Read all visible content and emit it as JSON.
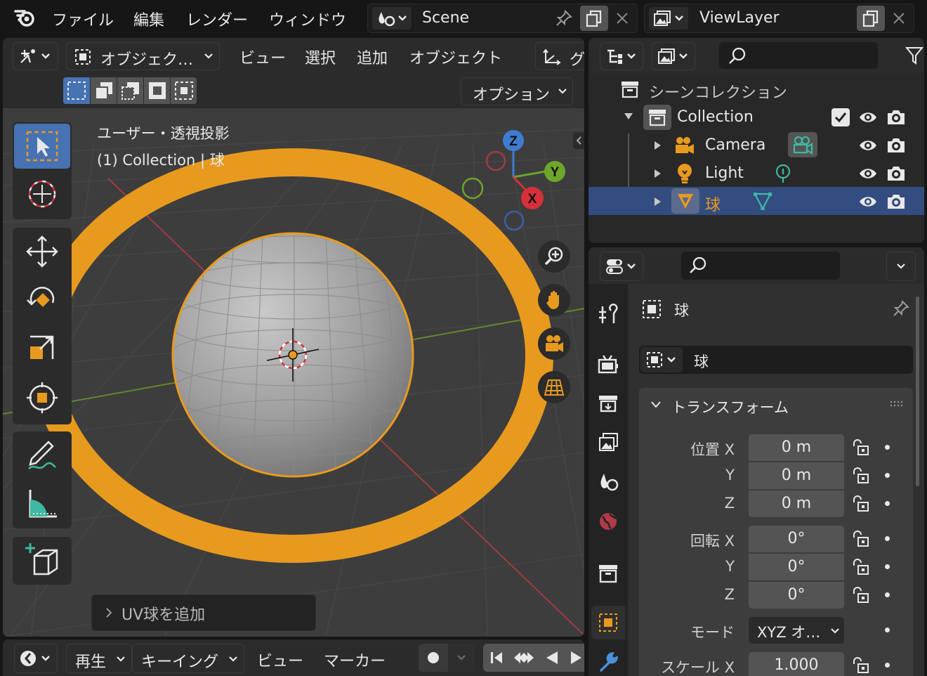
{
  "topbar": {
    "menu": [
      "ファイル",
      "編集",
      "レンダー",
      "ウィンドウ"
    ],
    "scene_name": "Scene",
    "viewlayer_name": "ViewLayer"
  },
  "viewport_header": {
    "mode_label": "オブジェク…",
    "menus": [
      "ビュー",
      "選択",
      "追加",
      "オブジェクト"
    ],
    "options_label": "オプション",
    "truncated_label": "グ"
  },
  "viewport": {
    "view_label": "ユーザー・透視投影",
    "object_label": "(1) Collection | 球",
    "gizmo_axes": {
      "z": "Z",
      "y": "Y",
      "x": "X"
    },
    "last_op": "UV球を追加"
  },
  "timeline": {
    "play_label": "再生",
    "keying_label": "キーイング",
    "view_label": "ビュー",
    "marker_label": "マーカー"
  },
  "outliner": {
    "root": "シーンコレクション",
    "collection": "Collection",
    "items": [
      {
        "name": "Camera",
        "selected": false
      },
      {
        "name": "Light",
        "selected": false
      },
      {
        "name": "球",
        "selected": true
      }
    ]
  },
  "properties": {
    "object_name": "球",
    "data_name": "球",
    "panel_title": "トランスフォーム",
    "location_label": "位置 X",
    "rotation_label": "回転 X",
    "mode_label": "モード",
    "scale_label": "スケール X",
    "axis_y": "Y",
    "axis_z": "Z",
    "location": {
      "x": "0 m",
      "y": "0 m",
      "z": "0 m"
    },
    "rotation": {
      "x": "0°",
      "y": "0°",
      "z": "0°"
    },
    "rotation_mode": "XYZ オ…",
    "scale_x": "1.000"
  },
  "colors": {
    "accent_orange": "#e89a1f",
    "selection_blue": "#334d80",
    "panel_bg": "#303030",
    "viewport_bg": "#3d3d3d"
  }
}
